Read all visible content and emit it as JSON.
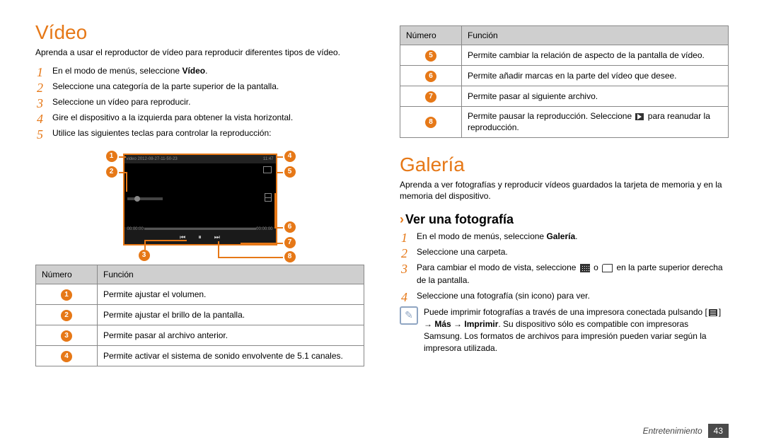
{
  "left": {
    "h1": "Vídeo",
    "intro": "Aprenda a usar el reproductor de vídeo para reproducir diferentes tipos de vídeo.",
    "steps": [
      {
        "n": "1",
        "pre": "En el modo de menús, seleccione ",
        "bold": "Vídeo",
        "post": "."
      },
      {
        "n": "2",
        "pre": "Seleccione una categoría de la parte superior de la pantalla."
      },
      {
        "n": "3",
        "pre": "Seleccione un vídeo para reproducir."
      },
      {
        "n": "4",
        "pre": "Gire el dispositivo a la izquierda para obtener la vista horizontal."
      },
      {
        "n": "5",
        "pre": "Utilice las siguientes teclas para controlar la reproducción:"
      }
    ],
    "screen": {
      "title": "video 2012-08-27-11-50-23",
      "clock": "11:47",
      "time_l": "00:00:00",
      "time_r": "00:00:00"
    },
    "table": {
      "h1": "Número",
      "h2": "Función",
      "rows": [
        {
          "n": "1",
          "t": "Permite ajustar el volumen."
        },
        {
          "n": "2",
          "t": "Permite ajustar el brillo de la pantalla."
        },
        {
          "n": "3",
          "t": "Permite pasar al archivo anterior."
        },
        {
          "n": "4",
          "t": "Permite activar el sistema de sonido envolvente de 5.1 canales."
        }
      ]
    }
  },
  "right": {
    "table": {
      "h1": "Número",
      "h2": "Función",
      "rows": [
        {
          "n": "5",
          "t": "Permite cambiar la relación de aspecto de la pantalla de vídeo."
        },
        {
          "n": "6",
          "t": "Permite añadir marcas en la parte del vídeo que desee."
        },
        {
          "n": "7",
          "t": "Permite pasar al siguiente archivo."
        },
        {
          "n": "8",
          "t_pre": "Permite pausar la reproducción. Seleccione ",
          "t_post": " para reanudar la reproducción."
        }
      ]
    },
    "h1": "Galería",
    "intro": "Aprenda a ver fotografías y reproducir vídeos guardados la tarjeta de memoria y en la memoria del dispositivo.",
    "h2": "Ver una fotografía",
    "steps": [
      {
        "n": "1",
        "pre": "En el modo de menús, seleccione ",
        "bold": "Galería",
        "post": "."
      },
      {
        "n": "2",
        "pre": "Seleccione una carpeta."
      },
      {
        "n": "3",
        "pre": "Para cambiar el modo de vista, seleccione ",
        "mid": " o ",
        "post": " en la parte superior derecha de la pantalla."
      },
      {
        "n": "4",
        "pre": "Seleccione una fotografía (sin icono) para ver."
      }
    ],
    "note": {
      "pre": "Puede imprimir fotografías a través de una impresora conectada pulsando [",
      "mid1": "] → ",
      "b1": "Más",
      "mid2": " → ",
      "b2": "Imprimir",
      "post": ". Su dispositivo sólo es compatible con impresoras Samsung. Los formatos de archivos para impresión pueden variar según la impresora utilizada."
    }
  },
  "footer": {
    "section": "Entretenimiento",
    "page": "43"
  }
}
